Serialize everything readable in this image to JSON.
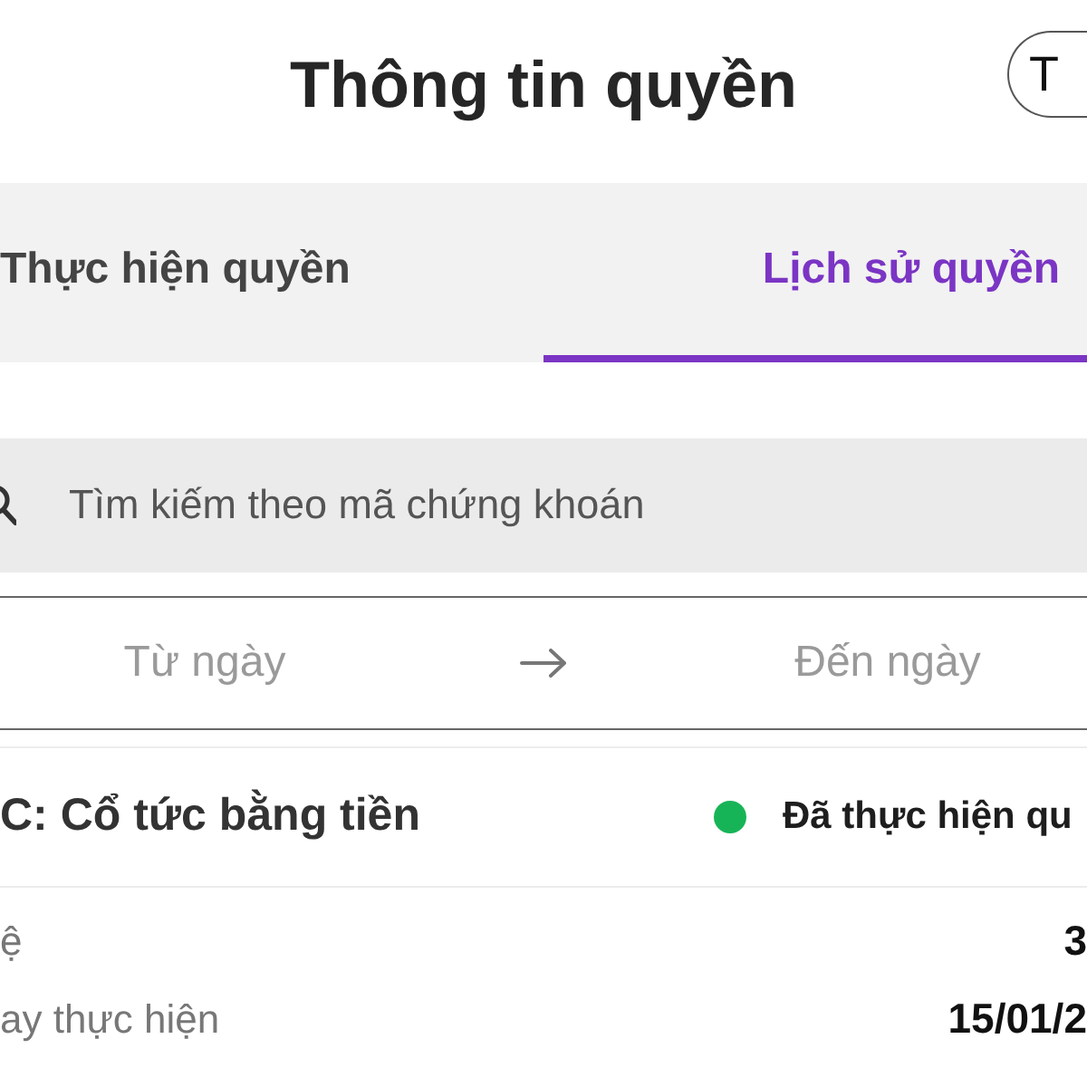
{
  "header": {
    "title": "Thông tin quyền",
    "account_button": "T"
  },
  "tabs": [
    {
      "label": "Thực hiện quyền",
      "selected": false
    },
    {
      "label": "Lịch sử quyền",
      "selected": true
    }
  ],
  "search": {
    "placeholder": "Tìm kiếm theo mã chứng khoán"
  },
  "date_range": {
    "from_placeholder": "Từ ngày",
    "to_placeholder": "Đến ngày"
  },
  "records": [
    {
      "title": "C: Cổ tức bằng tiền",
      "status": "Đã thực hiện qu",
      "color": "#17b457",
      "fields": [
        {
          "label": "ệ",
          "value": "3"
        },
        {
          "label": "ay thực hiện",
          "value": "15/01/2"
        }
      ]
    }
  ]
}
